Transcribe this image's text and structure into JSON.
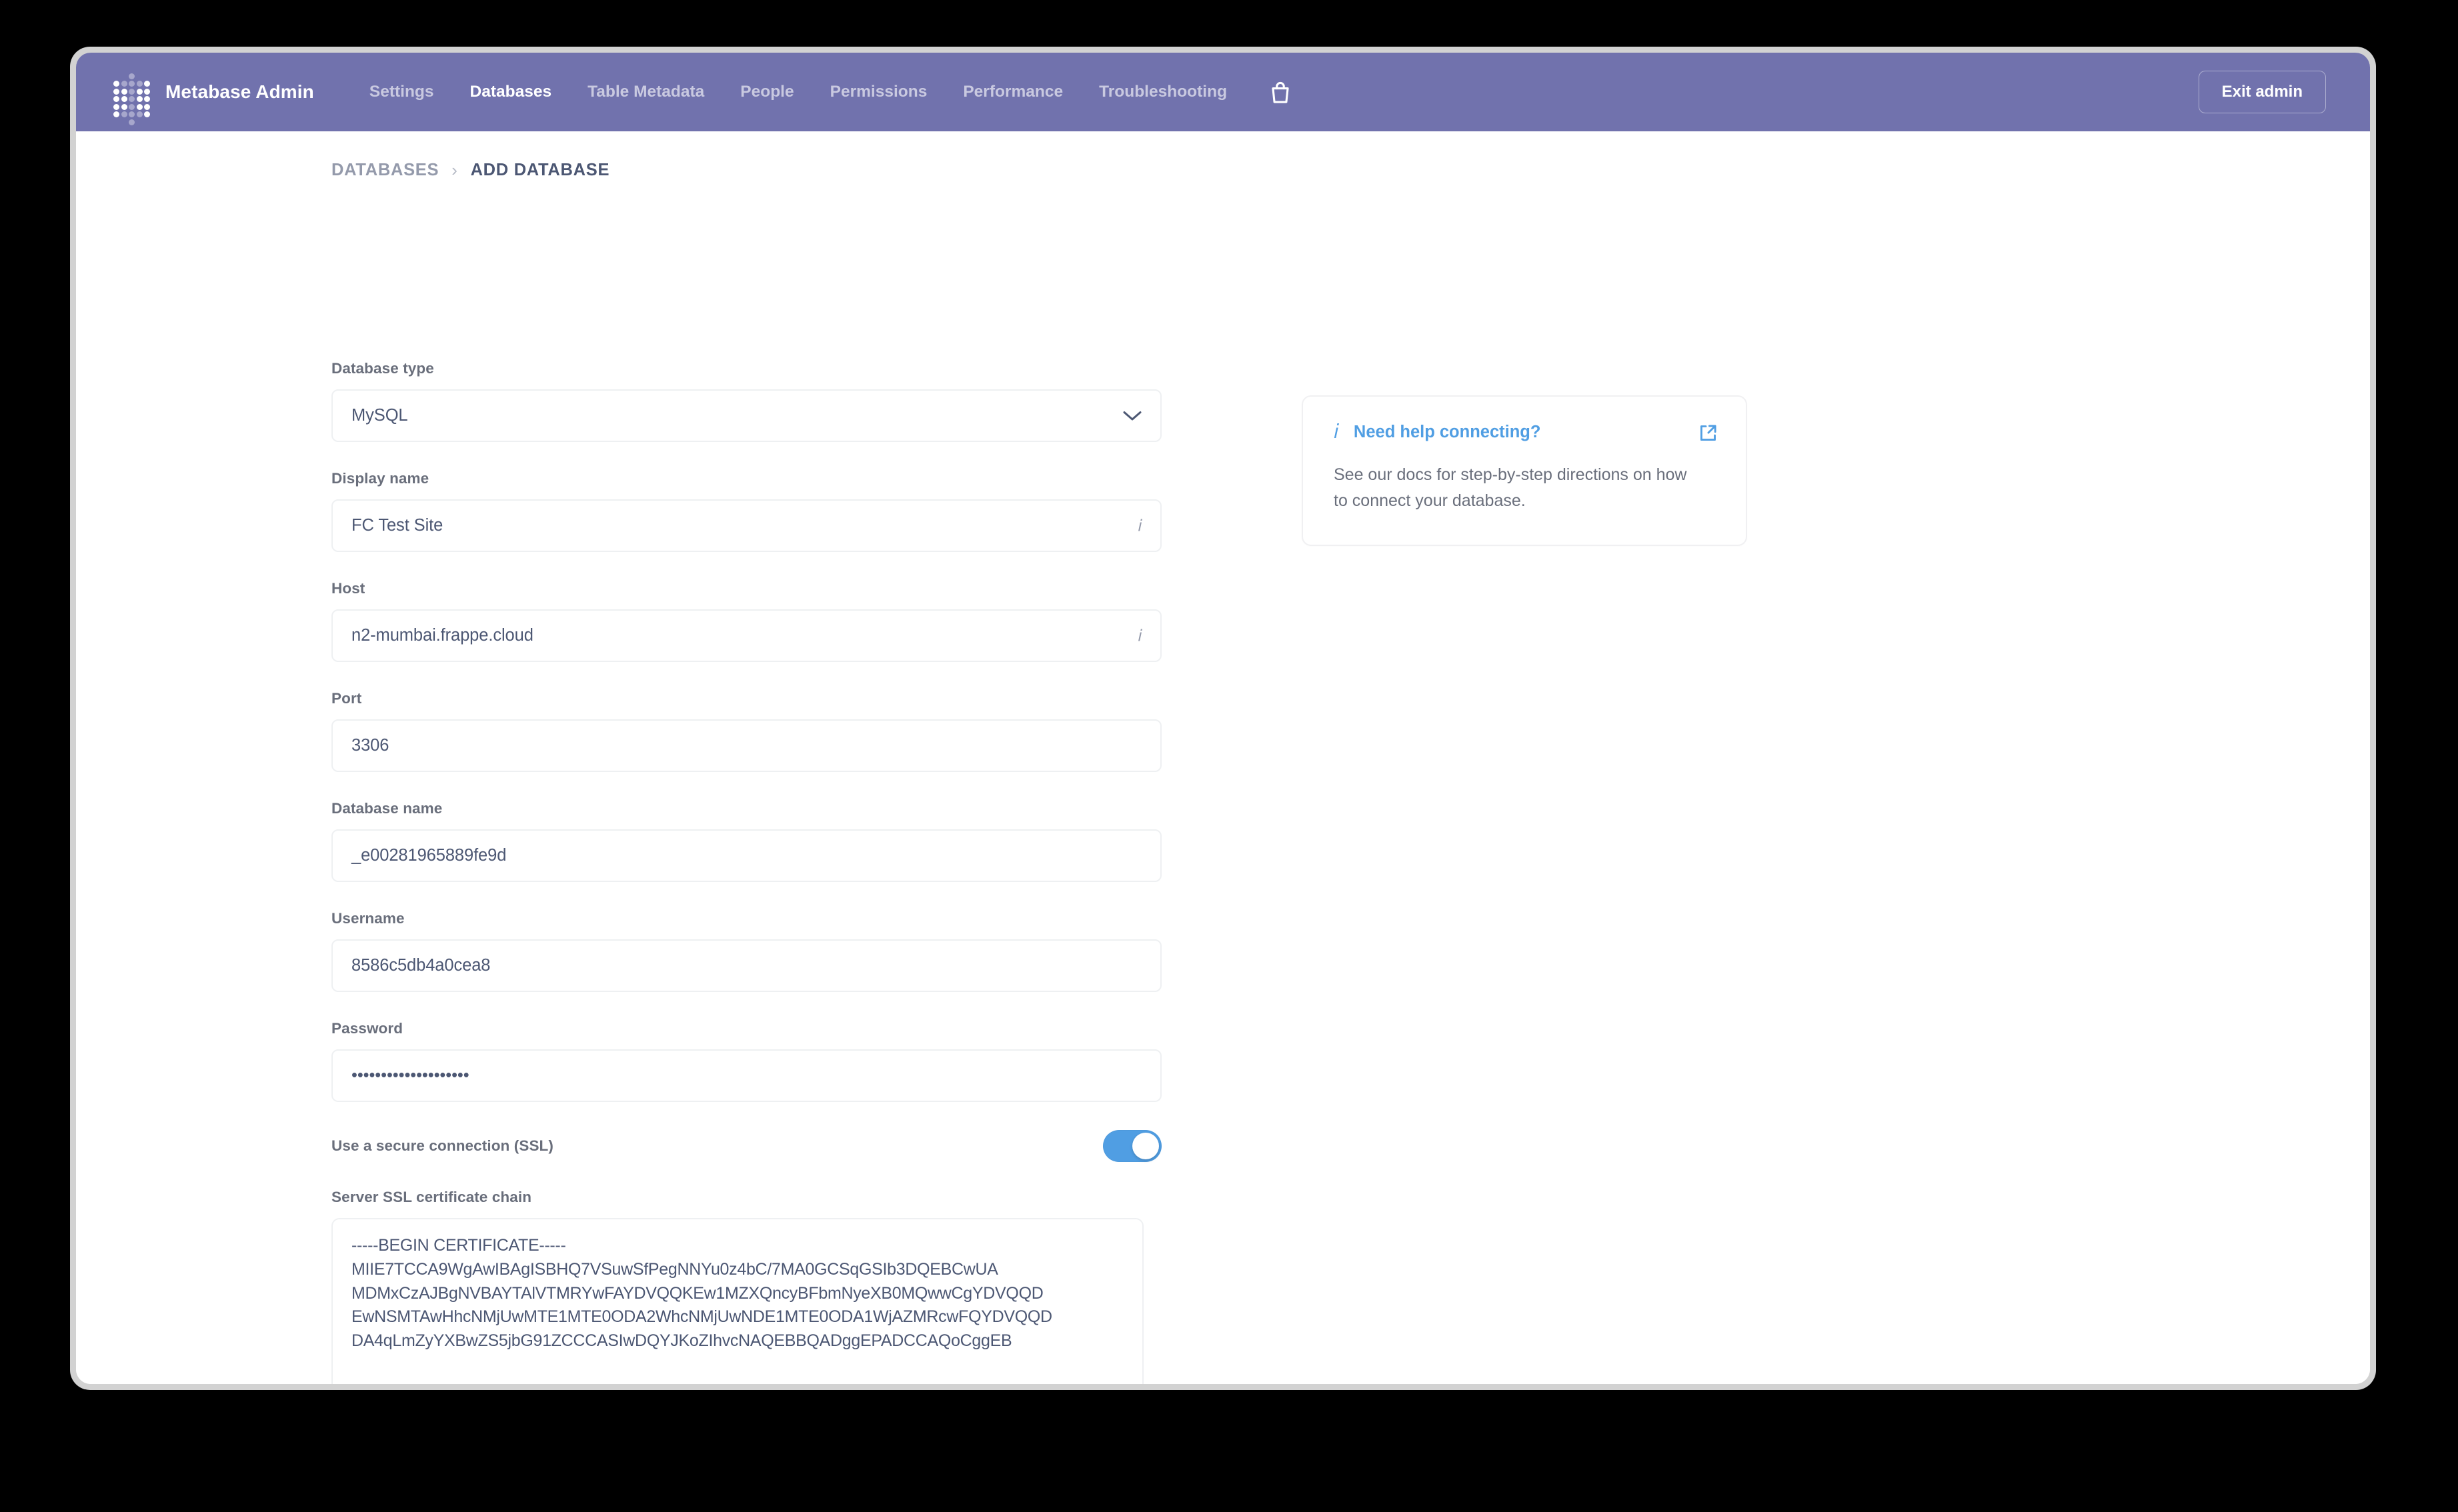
{
  "nav": {
    "logo_icon": "metabase-dot-grid-logo",
    "brand": "Metabase Admin",
    "links": [
      {
        "label": "Settings",
        "active": false
      },
      {
        "label": "Databases",
        "active": true
      },
      {
        "label": "Table Metadata",
        "active": false
      },
      {
        "label": "People",
        "active": false
      },
      {
        "label": "Permissions",
        "active": false
      },
      {
        "label": "Performance",
        "active": false
      },
      {
        "label": "Troubleshooting",
        "active": false
      }
    ],
    "store_icon": "shopping-bag-icon",
    "exit_admin_label": "Exit admin",
    "background_color": "#7172ad"
  },
  "breadcrumb": {
    "parent": "DATABASES",
    "separator": "›",
    "current": "ADD DATABASE"
  },
  "form": {
    "database_type": {
      "label": "Database type",
      "value": "MySQL",
      "icon": "chevron-down-icon"
    },
    "display_name": {
      "label": "Display name",
      "value": "FC Test Site",
      "icon": "info-icon"
    },
    "host": {
      "label": "Host",
      "value": "n2-mumbai.frappe.cloud",
      "icon": "info-icon"
    },
    "port": {
      "label": "Port",
      "value": "3306"
    },
    "database_name": {
      "label": "Database name",
      "value": "_e00281965889fe9d"
    },
    "username": {
      "label": "Username",
      "value": "8586c5db4a0cea8"
    },
    "password": {
      "label": "Password",
      "value": "••••••••••••••••••••"
    },
    "ssl": {
      "label": "Use a secure connection (SSL)",
      "enabled": true,
      "on_color": "#509ee3"
    },
    "ssl_cert": {
      "label": "Server SSL certificate chain",
      "value": "-----BEGIN CERTIFICATE-----\nMIIE7TCCA9WgAwIBAgISBHQ7VSuwSfPegNNYu0z4bC/7MA0GCSqGSIb3DQEBCwUA\nMDMxCzAJBgNVBAYTAlVTMRYwFAYDVQQKEw1MZXQncyBFbmNyeXB0MQwwCgYDVQQD\nEwNSMTAwHhcNMjUwMTE1MTE0ODA2WhcNMjUwNDE1MTE0ODA1WjAZMRcwFQYDVQQD\nDA4qLmZyYXBwZS5jbG91ZCCCASIwDQYJKoZIhvcNAQEBBQADggEPADCCAQoCggEB"
    }
  },
  "help_card": {
    "info_icon": "info-icon",
    "title": "Need help connecting?",
    "external_icon": "external-link-icon",
    "description": "See our docs for step-by-step directions on how to connect your database.",
    "accent_color": "#509ee3"
  }
}
